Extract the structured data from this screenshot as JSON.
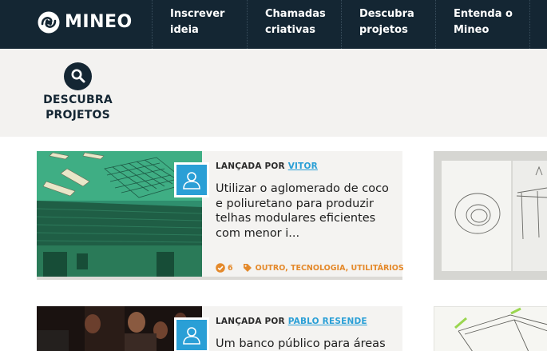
{
  "header": {
    "logo_text": "MINEO",
    "logo_icon": "mineo-logo-icon",
    "nav": [
      {
        "line1": "Inscrever",
        "line2": "ideia"
      },
      {
        "line1": "Chamadas",
        "line2": "criativas"
      },
      {
        "line1": "Descubra",
        "line2": "projetos"
      },
      {
        "line1": "Entenda o",
        "line2": "Mineo"
      }
    ]
  },
  "section": {
    "icon": "search-icon",
    "title_line1": "DESCUBRA",
    "title_line2": "PROJETOS"
  },
  "projects": [
    {
      "byline_prefix": "LANÇADA POR",
      "author": "VITOR",
      "title": "Utilizar o aglomerado de coco e poliuretano para produzir telhas modulares eficientes com menor i...",
      "supports": "6",
      "tags": "OUTRO, TECNOLOGIA, UTILITÁRIOS"
    },
    {
      "byline_prefix": "LANÇADA POR",
      "author": "PABLO RESENDE",
      "title": "Um banco público para áreas"
    }
  ],
  "colors": {
    "header_bg": "#142633",
    "subheader_bg": "#f3f2f0",
    "card_bg": "#f4f3f1",
    "author_link": "#2a9fd6",
    "meta_orange": "#e4892b",
    "avatar_blue": "#2a9fd6"
  }
}
